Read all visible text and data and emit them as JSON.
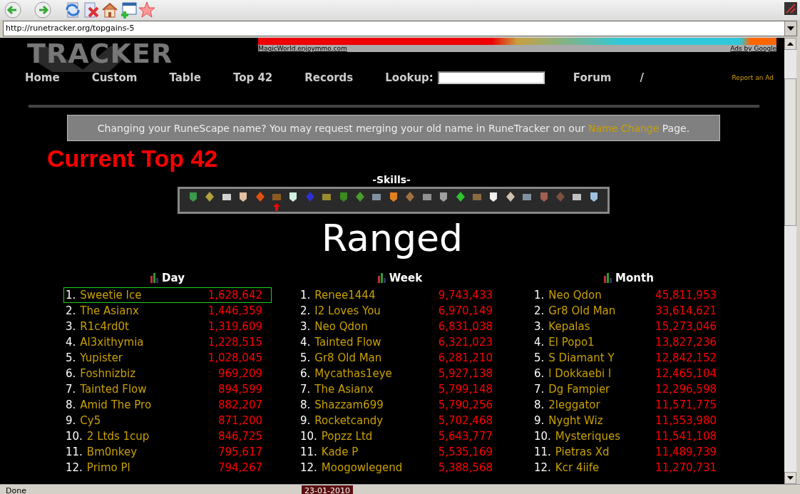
{
  "address_bar": {
    "value": "http://runetracker.org/topgains-5"
  },
  "header": {
    "logo": "TRACKER",
    "ad_link": "MagicWorld.enjoymmo.com",
    "ad_credit": "Ads by Google"
  },
  "nav": {
    "items": [
      "Home",
      "Custom",
      "Table",
      "Top 42",
      "Records"
    ],
    "lookup_label": "Lookup:",
    "after": [
      "Forum",
      "/"
    ],
    "report": "Report an Ad"
  },
  "notice": {
    "text": "Changing your RuneScape name? You may request merging your old name in RuneTracker on our ",
    "link": "Name Change",
    "tail": " Page."
  },
  "title": "Current Top 42",
  "skills": {
    "heading": "-Skills-",
    "items": [
      {
        "selected": false,
        "color": "#3a9a4a"
      },
      {
        "selected": false,
        "color": "#b0a040"
      },
      {
        "selected": false,
        "color": "#d0d0d0"
      },
      {
        "selected": false,
        "color": "#e0c0a0"
      },
      {
        "selected": false,
        "color": "#e05010"
      },
      {
        "selected": true,
        "color": "#8a5a20"
      },
      {
        "selected": false,
        "color": "#d0f0e0"
      },
      {
        "selected": false,
        "color": "#3030d0"
      },
      {
        "selected": false,
        "color": "#9a8a30"
      },
      {
        "selected": false,
        "color": "#3a8a20"
      },
      {
        "selected": false,
        "color": "#4a9a30"
      },
      {
        "selected": false,
        "color": "#8090a0"
      },
      {
        "selected": false,
        "color": "#e08020"
      },
      {
        "selected": false,
        "color": "#a07040"
      },
      {
        "selected": false,
        "color": "#909090"
      },
      {
        "selected": false,
        "color": "#a0a0a0"
      },
      {
        "selected": false,
        "color": "#30c030"
      },
      {
        "selected": false,
        "color": "#8a6a40"
      },
      {
        "selected": false,
        "color": "#f0f0f0"
      },
      {
        "selected": false,
        "color": "#d0c0b0"
      },
      {
        "selected": false,
        "color": "#8090a0"
      },
      {
        "selected": false,
        "color": "#a06050"
      },
      {
        "selected": false,
        "color": "#7a5040"
      },
      {
        "selected": false,
        "color": "#c0c0c0"
      },
      {
        "selected": false,
        "color": "#a0c0e0"
      }
    ]
  },
  "skill_name": "Ranged",
  "periods": [
    {
      "title": "Day",
      "rows": [
        {
          "rank": "1.",
          "name": "Sweetie Ice",
          "value": "1,628,642",
          "selected": true
        },
        {
          "rank": "2.",
          "name": "The Asianx",
          "value": "1,446,359",
          "selected": false
        },
        {
          "rank": "3.",
          "name": "R1c4rd0t",
          "value": "1,319,609",
          "selected": false
        },
        {
          "rank": "4.",
          "name": "Al3xithymia",
          "value": "1,228,515",
          "selected": false
        },
        {
          "rank": "5.",
          "name": "Yupister",
          "value": "1,028,045",
          "selected": false
        },
        {
          "rank": "6.",
          "name": "Foshnizbiz",
          "value": "969,209",
          "selected": false
        },
        {
          "rank": "7.",
          "name": "Tainted Flow",
          "value": "894,599",
          "selected": false
        },
        {
          "rank": "8.",
          "name": "Amid The Pro",
          "value": "882,207",
          "selected": false
        },
        {
          "rank": "9.",
          "name": "Cy5",
          "value": "871,200",
          "selected": false
        },
        {
          "rank": "10.",
          "name": "2 Ltds 1cup",
          "value": "846,725",
          "selected": false
        },
        {
          "rank": "11.",
          "name": "Bm0nkey",
          "value": "795,617",
          "selected": false
        },
        {
          "rank": "12.",
          "name": "Primo Pl",
          "value": "794,267",
          "selected": false
        }
      ]
    },
    {
      "title": "Week",
      "rows": [
        {
          "rank": "1.",
          "name": "Renee1444",
          "value": "9,743,433",
          "selected": false
        },
        {
          "rank": "2.",
          "name": "I2 Loves You",
          "value": "6,970,149",
          "selected": false
        },
        {
          "rank": "3.",
          "name": "Neo Qdon",
          "value": "6,831,038",
          "selected": false
        },
        {
          "rank": "4.",
          "name": "Tainted Flow",
          "value": "6,321,023",
          "selected": false
        },
        {
          "rank": "5.",
          "name": "Gr8 Old Man",
          "value": "6,281,210",
          "selected": false
        },
        {
          "rank": "6.",
          "name": "Mycathas1eye",
          "value": "5,927,138",
          "selected": false
        },
        {
          "rank": "7.",
          "name": "The Asianx",
          "value": "5,799,148",
          "selected": false
        },
        {
          "rank": "8.",
          "name": "Shazzam699",
          "value": "5,790,256",
          "selected": false
        },
        {
          "rank": "9.",
          "name": "Rocketcandy",
          "value": "5,702,468",
          "selected": false
        },
        {
          "rank": "10.",
          "name": "Popzz Ltd",
          "value": "5,643,777",
          "selected": false
        },
        {
          "rank": "11.",
          "name": "Kade P",
          "value": "5,535,169",
          "selected": false
        },
        {
          "rank": "12.",
          "name": "Moogowlegend",
          "value": "5,388,568",
          "selected": false
        }
      ]
    },
    {
      "title": "Month",
      "rows": [
        {
          "rank": "1.",
          "name": "Neo Qdon",
          "value": "45,811,953",
          "selected": false
        },
        {
          "rank": "2.",
          "name": "Gr8 Old Man",
          "value": "33,614,621",
          "selected": false
        },
        {
          "rank": "3.",
          "name": "Kepalas",
          "value": "15,273,046",
          "selected": false
        },
        {
          "rank": "4.",
          "name": "El Popo1",
          "value": "13,827,236",
          "selected": false
        },
        {
          "rank": "5.",
          "name": "S Diamant Y",
          "value": "12,842,152",
          "selected": false
        },
        {
          "rank": "6.",
          "name": "l Dokkaebi l",
          "value": "12,465,104",
          "selected": false
        },
        {
          "rank": "7.",
          "name": "Dg Fampier",
          "value": "12,296,598",
          "selected": false
        },
        {
          "rank": "8.",
          "name": "2leggator",
          "value": "11,571,775",
          "selected": false
        },
        {
          "rank": "9.",
          "name": "Nyght Wiz",
          "value": "11,553,980",
          "selected": false
        },
        {
          "rank": "10.",
          "name": "Mysteriques",
          "value": "11,541,108",
          "selected": false
        },
        {
          "rank": "11.",
          "name": "Pietras Xd",
          "value": "11,489,739",
          "selected": false
        },
        {
          "rank": "12.",
          "name": "Kcr 4iife",
          "value": "11,270,731",
          "selected": false
        }
      ]
    }
  ],
  "status_bar": {
    "text": "Done",
    "date": "23-01-2010"
  }
}
